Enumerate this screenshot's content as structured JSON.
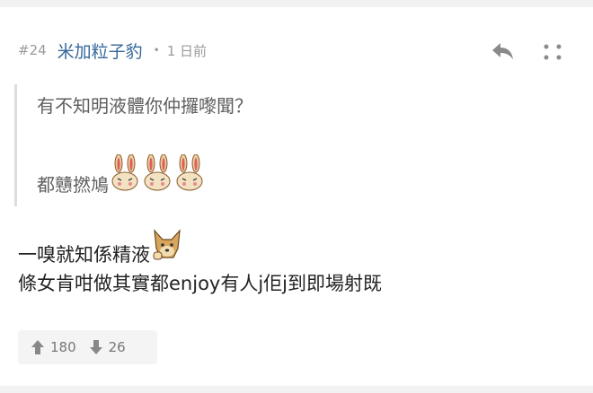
{
  "post": {
    "number": "#24",
    "username": "米加粒子豹",
    "separator": "•",
    "time": "1 日前"
  },
  "quote": {
    "line1": "有不知明液體你仲攞嚟聞？",
    "line2": "都戇撚鳩"
  },
  "body": {
    "line1": "一嗅就知係精液",
    "line2": "條女肯咁做其實都enjoy有人j佢j到即場射既"
  },
  "votes": {
    "up": "180",
    "down": "26"
  },
  "icons": {
    "reply": "reply-icon",
    "more": "more-icon",
    "up": "arrow-up-icon",
    "down": "arrow-down-icon",
    "rabbit": "rabbit-emoji-icon",
    "dog": "dog-emoji-icon"
  },
  "colors": {
    "username": "#35679a",
    "meta": "#9a9a9a",
    "quote_text": "#5f5f5f",
    "body_text": "#222222",
    "vote_bg": "#f4f4f4"
  }
}
